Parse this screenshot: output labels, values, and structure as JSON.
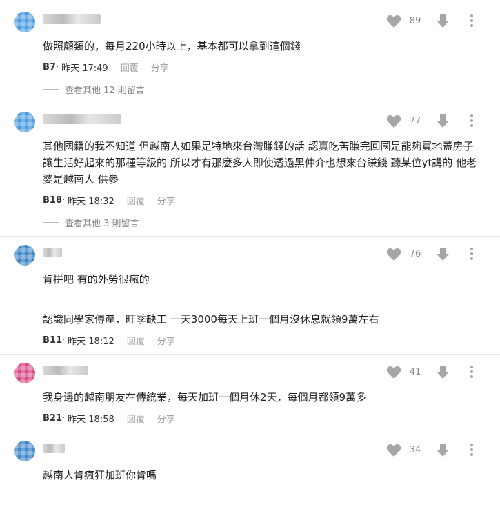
{
  "colors": {
    "icon_gray": "#a6a6a6",
    "divider": "#e6e6e6",
    "avatar_blue": "#3b8fd6",
    "avatar_pink": "#d84a86"
  },
  "icons": [
    "heart-icon",
    "thumbs-down-arrow-icon",
    "more-vertical-icon"
  ],
  "comments": [
    {
      "avatar_color": "#4a9be0",
      "likes": "89",
      "text": [
        "做照顧類的，每月220小時以上，基本都可以拿到這個錢"
      ],
      "floor": "B7",
      "time": "昨天 17:49",
      "reply": "回覆",
      "share": "分享",
      "more_replies": "查看其他 12 則留言"
    },
    {
      "avatar_color": "#4a9be0",
      "likes": "77",
      "text": [
        "其他國籍的我不知道 但越南人如果是特地來台灣賺錢的話 認真吃苦賺完回國是能夠買地蓋房子讓生活好起來的那種等級的 所以才有那麼多人即使透過黑仲介也想來台賺錢 聽某位yt講的 他老婆是越南人 供參"
      ],
      "floor": "B18",
      "time": "昨天 18:32",
      "reply": "回覆",
      "share": "分享",
      "more_replies": "查看其他 3 則留言"
    },
    {
      "avatar_color": "#3d85c6",
      "likes": "76",
      "text": [
        "肯拼吧 有的外勞很瘋的",
        "",
        "認識同學家傳產，旺季缺工 一天3000每天上班一個月沒休息就領9萬左右"
      ],
      "floor": "B11",
      "time": "昨天 18:12",
      "reply": "回覆",
      "share": "分享",
      "more_replies": ""
    },
    {
      "avatar_color": "#d84a86",
      "likes": "41",
      "text": [
        "我身邊的越南朋友在傳統業，每天加班一個月休2天，每個月都領9萬多"
      ],
      "floor": "B21",
      "time": "昨天 18:58",
      "reply": "回覆",
      "share": "分享",
      "more_replies": ""
    },
    {
      "avatar_color": "#3d85c6",
      "likes": "34",
      "text": [
        "越南人肯瘋狂加班你肯嗎"
      ],
      "floor": "",
      "time": "",
      "reply": "",
      "share": "",
      "more_replies": ""
    }
  ]
}
